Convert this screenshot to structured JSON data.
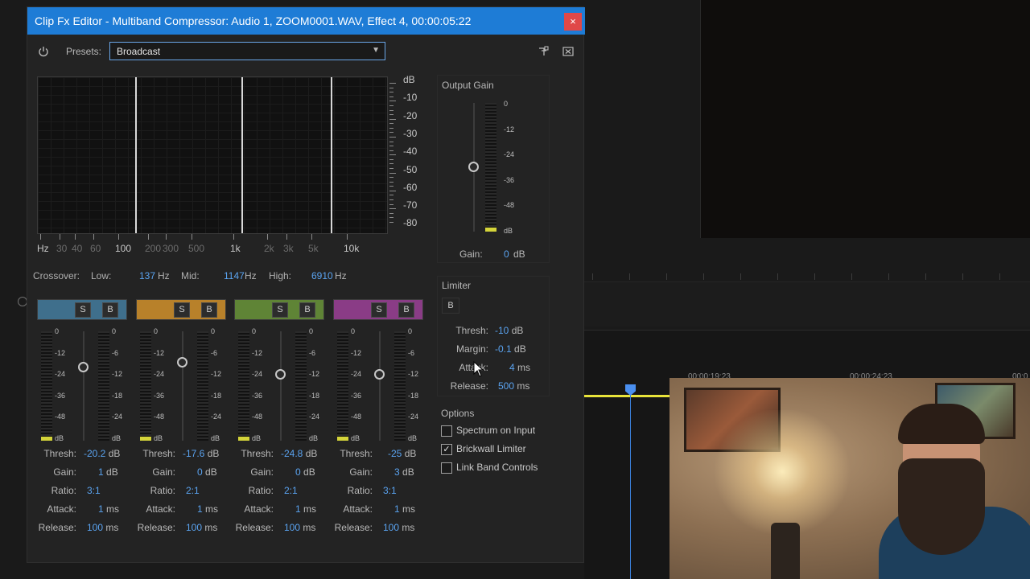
{
  "dialog": {
    "title": "Clip Fx Editor - Multiband Compressor: Audio 1, ZOOM0001.WAV, Effect 4, 00:00:05:22",
    "close_label": "×",
    "presets_label": "Presets:",
    "preset_value": "Broadcast"
  },
  "graph": {
    "db_labels": [
      "dB",
      "-10",
      "-20",
      "-30",
      "-40",
      "-50",
      "-60",
      "-70",
      "-80"
    ],
    "hz_labels": [
      {
        "t": "Hz",
        "strong": true
      },
      {
        "t": "30",
        "strong": false
      },
      {
        "t": "40",
        "strong": false
      },
      {
        "t": "60",
        "strong": false
      },
      {
        "t": "100",
        "strong": true
      },
      {
        "t": "200",
        "strong": false
      },
      {
        "t": "300",
        "strong": false
      },
      {
        "t": "500",
        "strong": false
      },
      {
        "t": "1k",
        "strong": true
      },
      {
        "t": "2k",
        "strong": false
      },
      {
        "t": "3k",
        "strong": false
      },
      {
        "t": "5k",
        "strong": false
      },
      {
        "t": "10k",
        "strong": true
      }
    ]
  },
  "crossover": {
    "label": "Crossover:",
    "low_label": "Low:",
    "low_value": "137",
    "low_unit": "Hz",
    "mid_label": "Mid:",
    "mid_value": "1147",
    "mid_unit": "Hz",
    "high_label": "High:",
    "high_value": "6910",
    "high_unit": "Hz"
  },
  "meter_scale": {
    "left": [
      "0",
      "-12",
      "-24",
      "-36",
      "-48",
      "dB"
    ],
    "right": [
      "0",
      "-6",
      "-12",
      "-18",
      "-24",
      "dB"
    ]
  },
  "param_labels": {
    "thresh": "Thresh:",
    "gain": "Gain:",
    "ratio": "Ratio:",
    "attack": "Attack:",
    "release": "Release:"
  },
  "bands": [
    {
      "color": "#3f6f8c",
      "solo": "S",
      "bypass": "B",
      "thresh": "-20.2",
      "thresh_unit": "dB",
      "gain": "1",
      "gain_unit": "dB",
      "ratio": "3:1",
      "attack": "1",
      "attack_unit": "ms",
      "release": "100",
      "release_unit": "ms",
      "knob_level": 0.33
    },
    {
      "color": "#b8812a",
      "solo": "S",
      "bypass": "B",
      "thresh": "-17.6",
      "thresh_unit": "dB",
      "gain": "0",
      "gain_unit": "dB",
      "ratio": "2:1",
      "attack": "1",
      "attack_unit": "ms",
      "release": "100",
      "release_unit": "ms",
      "knob_level": 0.29
    },
    {
      "color": "#5f8436",
      "solo": "S",
      "bypass": "B",
      "thresh": "-24.8",
      "thresh_unit": "dB",
      "gain": "0",
      "gain_unit": "dB",
      "ratio": "2:1",
      "attack": "1",
      "attack_unit": "ms",
      "release": "100",
      "release_unit": "ms",
      "knob_level": 0.4
    },
    {
      "color": "#8a3c86",
      "solo": "S",
      "bypass": "B",
      "thresh": "-25",
      "thresh_unit": "dB",
      "gain": "3",
      "gain_unit": "dB",
      "ratio": "3:1",
      "attack": "1",
      "attack_unit": "ms",
      "release": "100",
      "release_unit": "ms",
      "knob_level": 0.4
    }
  ],
  "output_gain": {
    "title": "Output Gain",
    "scale": [
      "0",
      "-12",
      "-24",
      "-36",
      "-48",
      "dB"
    ],
    "gain_label": "Gain:",
    "gain_value": "0",
    "gain_unit": "dB"
  },
  "limiter": {
    "title": "Limiter",
    "bypass": "B",
    "thresh_label": "Thresh:",
    "thresh_value": "-10",
    "thresh_unit": "dB",
    "margin_label": "Margin:",
    "margin_value": "-0.1",
    "margin_unit": "dB",
    "attack_label": "Attack:",
    "attack_value": "4",
    "attack_unit": "ms",
    "release_label": "Release:",
    "release_value": "500",
    "release_unit": "ms"
  },
  "options": {
    "title": "Options",
    "items": [
      {
        "label": "Spectrum on Input",
        "checked": false
      },
      {
        "label": "Brickwall Limiter",
        "checked": true
      },
      {
        "label": "Link Band Controls",
        "checked": false
      }
    ]
  },
  "timeline": {
    "timecodes": [
      "00:00:19:23",
      "00:00:24:23",
      "00:0"
    ]
  },
  "colors": {
    "accent": "#1e7cd6",
    "value_blue": "#5aa3f0",
    "close_red": "#e04848",
    "meter_yellow": "#d4d43a"
  }
}
